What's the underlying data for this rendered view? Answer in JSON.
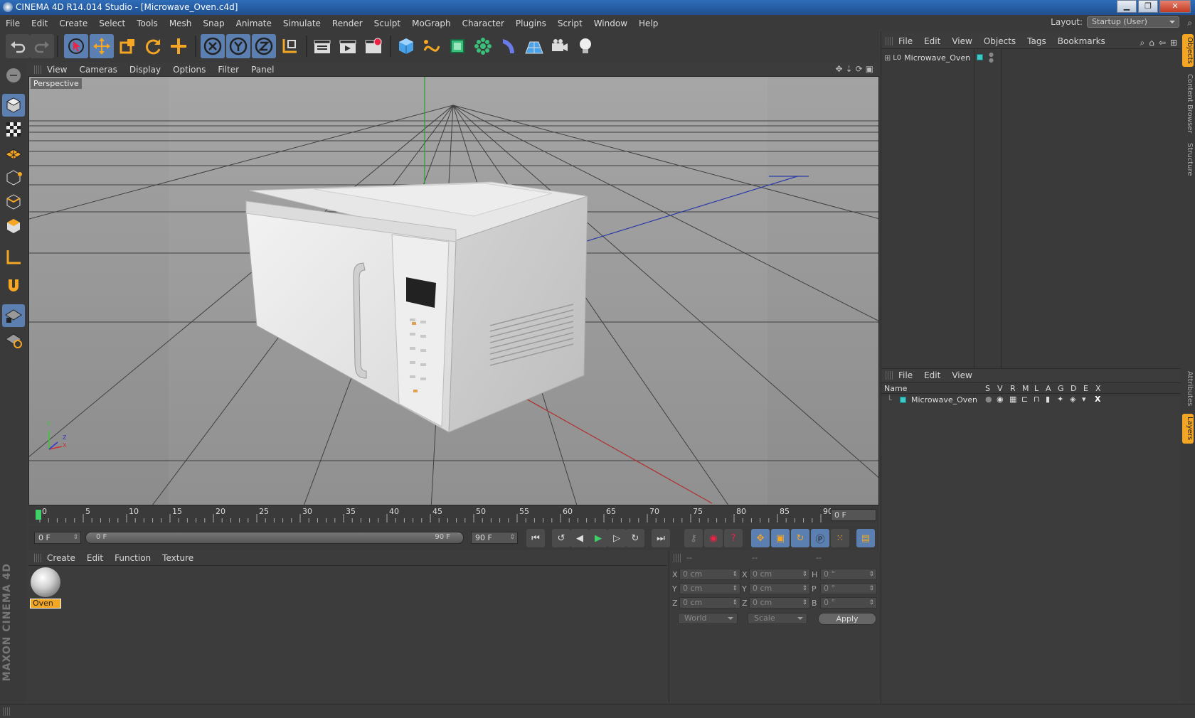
{
  "window": {
    "title": "CINEMA 4D R14.014 Studio - [Microwave_Oven.c4d]",
    "buttons": [
      "▁",
      "❐",
      "✕"
    ]
  },
  "menu": [
    "File",
    "Edit",
    "Create",
    "Select",
    "Tools",
    "Mesh",
    "Snap",
    "Animate",
    "Simulate",
    "Render",
    "Sculpt",
    "MoGraph",
    "Character",
    "Plugins",
    "Script",
    "Window",
    "Help"
  ],
  "layout": {
    "label": "Layout:",
    "value": "Startup (User)"
  },
  "viewport": {
    "menu": [
      "View",
      "Cameras",
      "Display",
      "Options",
      "Filter",
      "Panel"
    ],
    "label": "Perspective",
    "axes": {
      "y": "Y",
      "x": "X",
      "z": "Z"
    }
  },
  "timeline": {
    "ticks": [
      "0",
      "5",
      "10",
      "15",
      "20",
      "25",
      "30",
      "35",
      "40",
      "45",
      "50",
      "55",
      "60",
      "65",
      "70",
      "75",
      "80",
      "85",
      "90"
    ],
    "current": "0 F"
  },
  "playback": {
    "start": "0 F",
    "slider_left": "0 F",
    "slider_right": "90 F",
    "end": "90 F"
  },
  "materials": {
    "menu": [
      "Create",
      "Edit",
      "Function",
      "Texture"
    ],
    "items": [
      {
        "name": "Oven"
      }
    ]
  },
  "coords": {
    "headers": [
      "--",
      "--",
      "--"
    ],
    "rows": [
      {
        "l1": "X",
        "v1": "0 cm",
        "l2": "X",
        "v2": "0 cm",
        "l3": "H",
        "v3": "0 °"
      },
      {
        "l1": "Y",
        "v1": "0 cm",
        "l2": "Y",
        "v2": "0 cm",
        "l3": "P",
        "v3": "0 °"
      },
      {
        "l1": "Z",
        "v1": "0 cm",
        "l2": "Z",
        "v2": "0 cm",
        "l3": "B",
        "v3": "0 °"
      }
    ],
    "space": "World",
    "mode": "Scale",
    "apply": "Apply"
  },
  "objects": {
    "menu": [
      "File",
      "Edit",
      "View",
      "Objects",
      "Tags",
      "Bookmarks"
    ],
    "items": [
      {
        "name": "Microwave_Oven"
      }
    ]
  },
  "layers": {
    "menu": [
      "File",
      "Edit",
      "View"
    ],
    "columns": [
      "Name",
      "S",
      "V",
      "R",
      "M",
      "L",
      "A",
      "G",
      "D",
      "E",
      "X"
    ],
    "items": [
      {
        "name": "Microwave_Oven"
      }
    ]
  },
  "side_tabs": [
    "Objects",
    "Content Browser",
    "Structure",
    "Attributes",
    "Layers"
  ],
  "brand": "MAXON CINEMA 4D",
  "colors": {
    "accent": "#5a7fb0",
    "material_label": "#f3a623",
    "layer_color": "#3fc8c8"
  }
}
